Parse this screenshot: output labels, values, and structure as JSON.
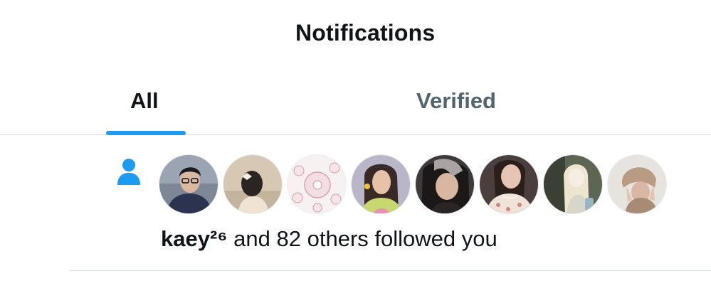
{
  "header": {
    "title": "Notifications"
  },
  "tabs": [
    {
      "label": "All",
      "active": true
    },
    {
      "label": "Verified",
      "active": false
    }
  ],
  "colors": {
    "accent": "#1d9bf0",
    "text_primary": "#0f1419",
    "text_secondary": "#536471",
    "divider": "#cfd9de"
  },
  "notification": {
    "type_icon": "person-icon",
    "avatars": [
      {
        "icon": "user-avatar-1"
      },
      {
        "icon": "user-avatar-2"
      },
      {
        "icon": "user-avatar-3"
      },
      {
        "icon": "user-avatar-4"
      },
      {
        "icon": "user-avatar-5"
      },
      {
        "icon": "user-avatar-6"
      },
      {
        "icon": "user-avatar-7"
      },
      {
        "icon": "user-avatar-8"
      }
    ],
    "name": "kaey²⁶",
    "message": " and 82 others followed you"
  }
}
